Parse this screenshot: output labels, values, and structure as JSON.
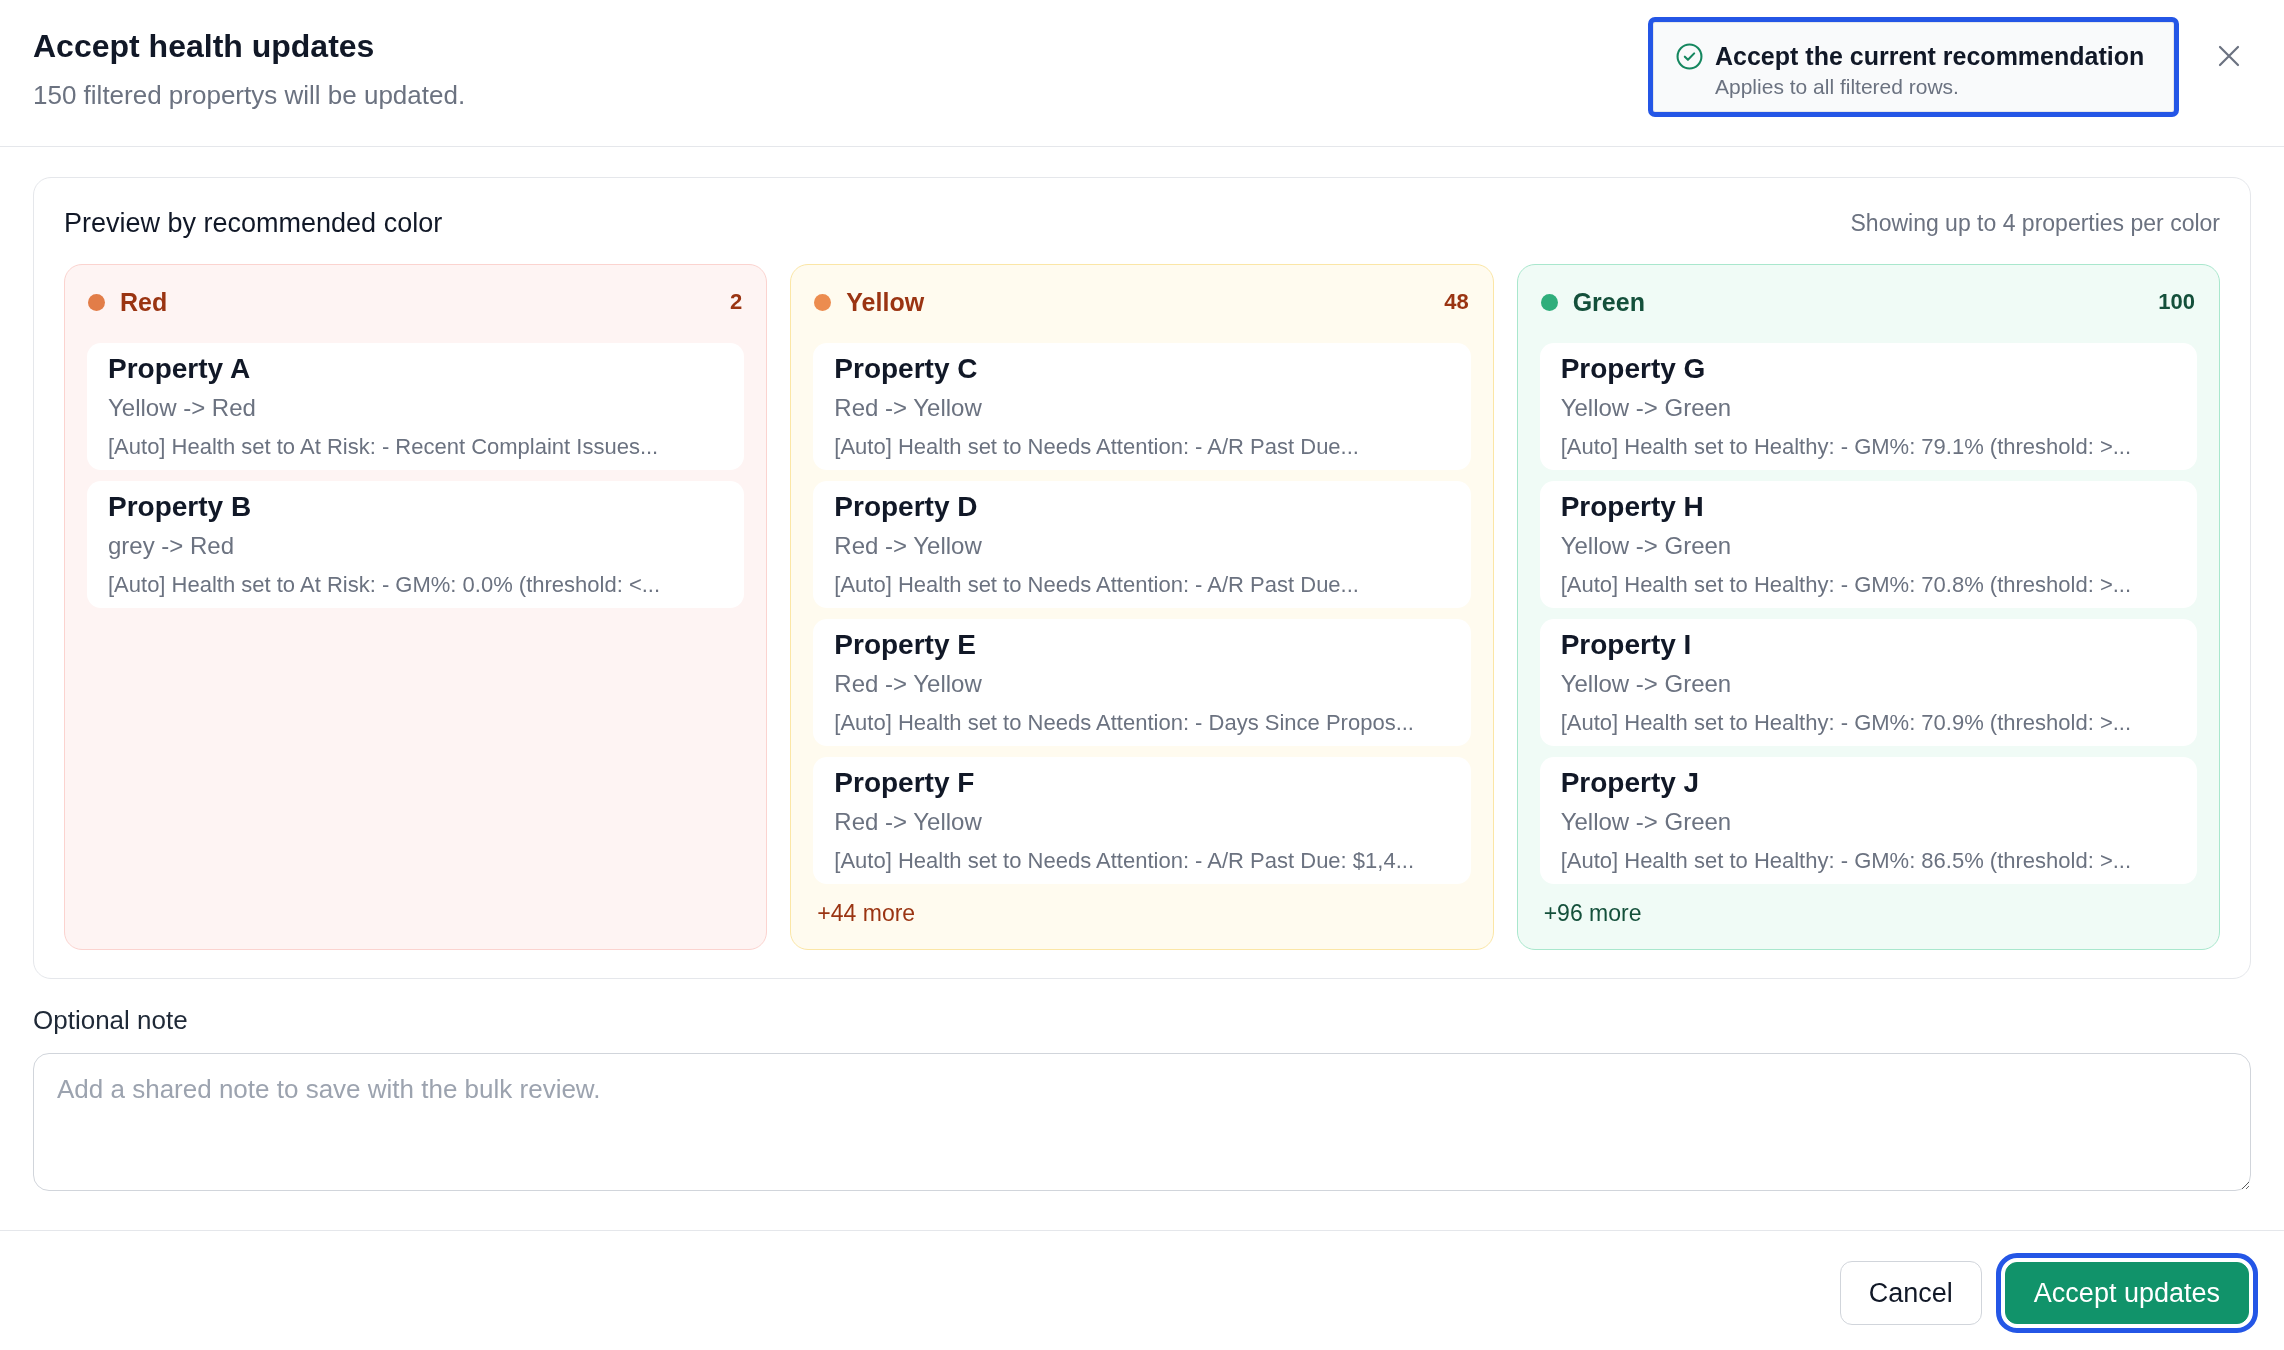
{
  "dialog": {
    "title": "Accept health updates",
    "subtitle": "150 filtered propertys will be updated.",
    "recommendation_option": {
      "title": "Accept the current recommendation",
      "description": "Applies to all filtered rows.",
      "selected": true,
      "highlighted": true
    }
  },
  "preview": {
    "title": "Preview by recommended color",
    "note": "Showing up to 4 properties per color",
    "groups": [
      {
        "name": "Red",
        "count": "2",
        "color": "#e27d48",
        "kind": "red",
        "properties": [
          {
            "name": "Property A",
            "change": "Yellow -> Red",
            "detail": "[Auto] Health set to At Risk: - Recent Complaint Issues..."
          },
          {
            "name": "Property B",
            "change": "grey -> Red",
            "detail": "[Auto] Health set to At Risk: - GM%: 0.0% (threshold: <..."
          }
        ]
      },
      {
        "name": "Yellow",
        "count": "48",
        "color": "#ec8c4f",
        "kind": "yellow",
        "properties": [
          {
            "name": "Property C",
            "change": "Red -> Yellow",
            "detail": "[Auto] Health set to Needs Attention: - A/R Past Due..."
          },
          {
            "name": "Property D",
            "change": "Red -> Yellow",
            "detail": "[Auto] Health set to Needs Attention: - A/R Past Due..."
          },
          {
            "name": "Property E",
            "change": "Red -> Yellow",
            "detail": "[Auto] Health set to Needs Attention: - Days Since Propos..."
          },
          {
            "name": "Property F",
            "change": "Red -> Yellow",
            "detail": "[Auto] Health set to Needs Attention: - A/R Past Due: $1,4..."
          }
        ],
        "more": "+44 more"
      },
      {
        "name": "Green",
        "count": "100",
        "color": "#2fae7b",
        "kind": "green",
        "properties": [
          {
            "name": "Property G",
            "change": "Yellow -> Green",
            "detail": "[Auto] Health set to Healthy: - GM%: 79.1% (threshold: >..."
          },
          {
            "name": "Property H",
            "change": "Yellow -> Green",
            "detail": "[Auto] Health set to Healthy: - GM%: 70.8% (threshold: >..."
          },
          {
            "name": "Property I",
            "change": "Yellow -> Green",
            "detail": "[Auto] Health set to Healthy: - GM%: 70.9% (threshold: >..."
          },
          {
            "name": "Property J",
            "change": "Yellow -> Green",
            "detail": "[Auto] Health set to Healthy: - GM%: 86.5% (threshold: >..."
          }
        ],
        "more": "+96 more"
      }
    ]
  },
  "note": {
    "label": "Optional note",
    "placeholder": "Add a shared note to save with the bulk review."
  },
  "footer": {
    "buttons": [
      {
        "label": "Cancel",
        "kind": "secondary",
        "highlighted": false
      },
      {
        "label": "Accept updates",
        "kind": "primary",
        "highlighted": true
      }
    ]
  }
}
